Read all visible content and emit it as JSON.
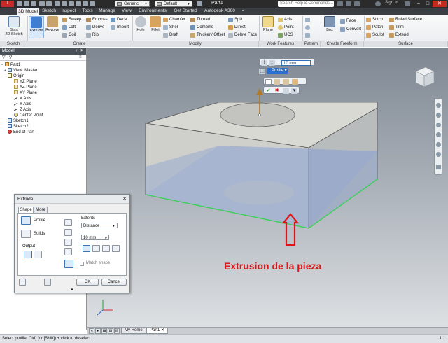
{
  "titlebar": {
    "app_letter": "I",
    "material": "Generic",
    "appearance": "Default",
    "document": "Part1",
    "search_placeholder": "Search Help & Commands...",
    "signin": "Sign In"
  },
  "tabs": [
    "3D Model",
    "Sketch",
    "Inspect",
    "Tools",
    "Manage",
    "View",
    "Environments",
    "Get Started",
    "Autodesk A360"
  ],
  "ribbon": {
    "sketch": {
      "start_line1": "Start",
      "start_line2": "2D Sketch"
    },
    "create": {
      "extrude": "Extrude",
      "revolve": "Revolve",
      "sweep": "Sweep",
      "emboss": "Emboss",
      "decal": "Decal",
      "loft": "Loft",
      "derive": "Derive",
      "import": "Import",
      "coil": "Coil",
      "rib": "Rib"
    },
    "modify": {
      "hole": "Hole",
      "fillet": "Fillet",
      "chamfer": "Chamfer",
      "thread": "Thread",
      "split": "Split",
      "shell": "Shell",
      "combine": "Combine",
      "direct": "Direct",
      "draft": "Draft",
      "thicken": "Thicken/ Offset",
      "delete_face": "Delete Face"
    },
    "work": {
      "plane": "Plane",
      "axis": "Axis",
      "point": "Point",
      "ucs": "UCS"
    },
    "freeform": {
      "box": "Box",
      "face": "Face",
      "convert": "Convert"
    },
    "surface": {
      "stitch": "Stitch",
      "ruled": "Ruled Surface",
      "patch": "Patch",
      "trim": "Trim",
      "sculpt": "Sculpt",
      "extend": "Extend"
    },
    "groups": [
      "Sketch",
      "Create",
      "Modify",
      "Work Features",
      "Pattern",
      "Create Freeform",
      "Surface"
    ]
  },
  "browser": {
    "title": "Model",
    "nodes": [
      "Part1",
      "View: Master",
      "Origin",
      "YZ Plane",
      "XZ Plane",
      "XY Plane",
      "X Axis",
      "Y Axis",
      "Z Axis",
      "Center Point",
      "Sketch1",
      "Sketch2",
      "End of Part"
    ]
  },
  "minitoolbar": {
    "distance": "10 mm",
    "profile": "Profile"
  },
  "dialog": {
    "title": "Extrude",
    "tabs": [
      "Shape",
      "More"
    ],
    "profile": "Profile",
    "solids": "Solids",
    "output": "Output",
    "extents": "Extents",
    "extents_value": "Distance",
    "distance": "10 mm",
    "match_shape": "Match shape",
    "ok": "OK",
    "cancel": "Cancel"
  },
  "annotation": "Extrusion de la pieza",
  "doc_tabs": [
    "My Home",
    "Part1"
  ],
  "status": {
    "message": "Select profile. Ctrl] (or [Shift]) + click to deselect",
    "counts": "1 1"
  },
  "colors": {
    "annotation": "#e0141b",
    "selected_edge": "#3cd05a",
    "part_face": "#d8d8d3"
  }
}
